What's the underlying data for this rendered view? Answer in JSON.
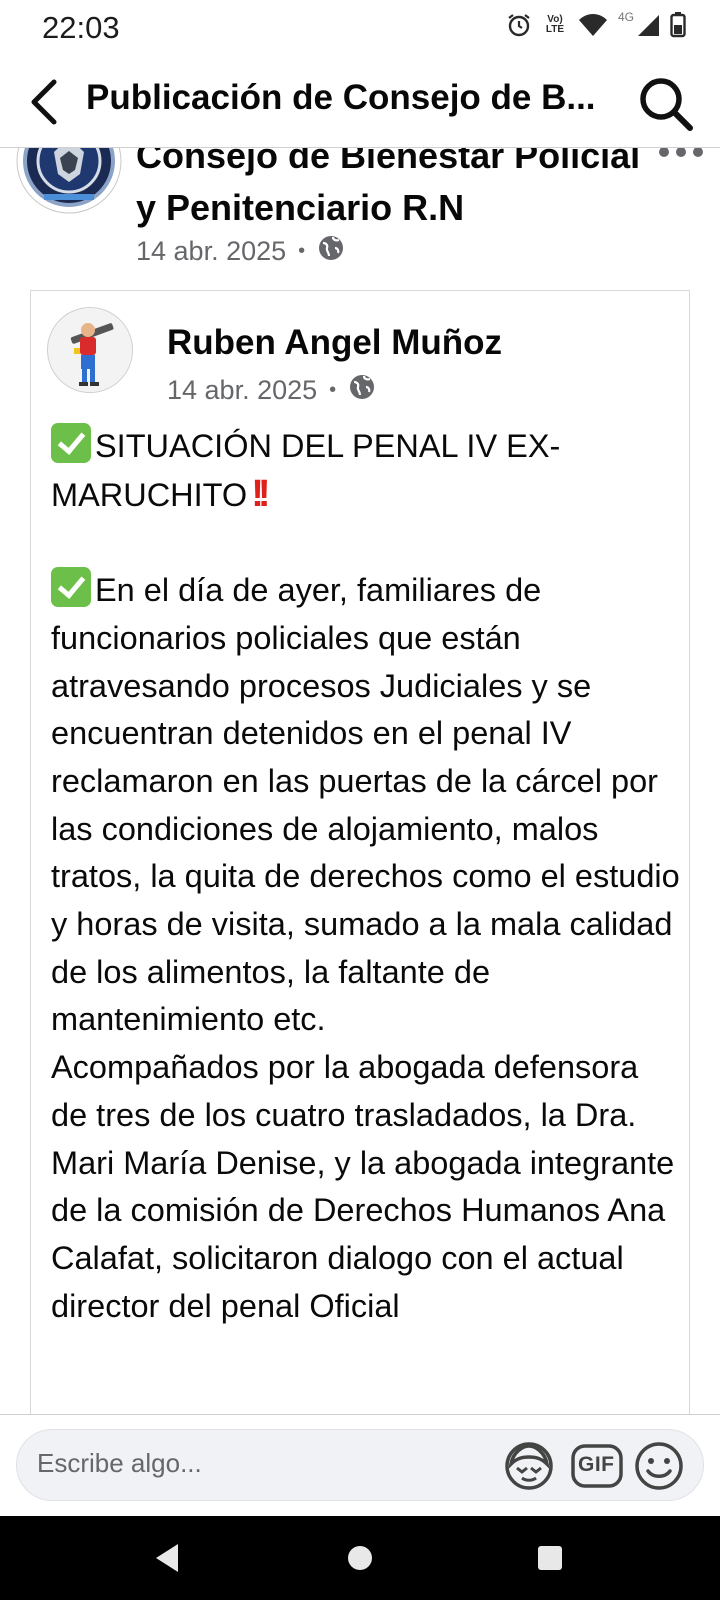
{
  "status_bar": {
    "time": "22:03",
    "volte_top": "Vo)",
    "volte_bottom": "LTE",
    "network": "4G",
    "icons": [
      "alarm-icon",
      "volte-icon",
      "wifi-icon",
      "signal-icon",
      "battery-icon"
    ]
  },
  "header": {
    "title": "Publicación de Consejo de B...",
    "back_icon": "back-arrow-icon",
    "search_icon": "search-icon"
  },
  "page_post": {
    "page_name": "Consejo de Bienestar Policial y Penitenciario R.N",
    "date": "14 abr. 2025",
    "separator": "•",
    "visibility_icon": "globe-icon",
    "more_icon": "more-icon"
  },
  "shared_post": {
    "author": "Ruben Angel Muñoz",
    "date": "14 abr. 2025",
    "separator": "•",
    "visibility_icon": "globe-icon",
    "heading": "SITUACIÓN DEL PENAL IV EX-MARUCHITO",
    "body": "En el día de ayer, familiares de funcionarios policiales que están atravesando procesos Judiciales y se encuentran detenidos en el penal IV reclamaron en las puertas de la cárcel por las condiciones de alojamiento, malos tratos, la quita de derechos como el estudio y horas de visita, sumado a la mala calidad de los alimentos, la faltante de mantenimiento etc.\nAcompañados por la abogada defensora de tres de los cuatro trasladados, la Dra. Mari María Denise, y la abogada integrante de la comisión de Derechos Humanos Ana Calafat, solicitaron dialogo con el actual director del penal Oficial"
  },
  "composer": {
    "placeholder": "Escribe algo...",
    "sticker_icon": "avatar-sticker-icon",
    "gif_label": "GIF",
    "emoji_icon": "smiley-icon"
  },
  "nav": {
    "icons": [
      "back-triangle-icon",
      "home-circle-icon",
      "recents-square-icon"
    ]
  },
  "colors": {
    "text": "#050505",
    "meta": "#65676b",
    "check_emoji": "#6cc04a",
    "bang_emoji": "#e0201b"
  }
}
